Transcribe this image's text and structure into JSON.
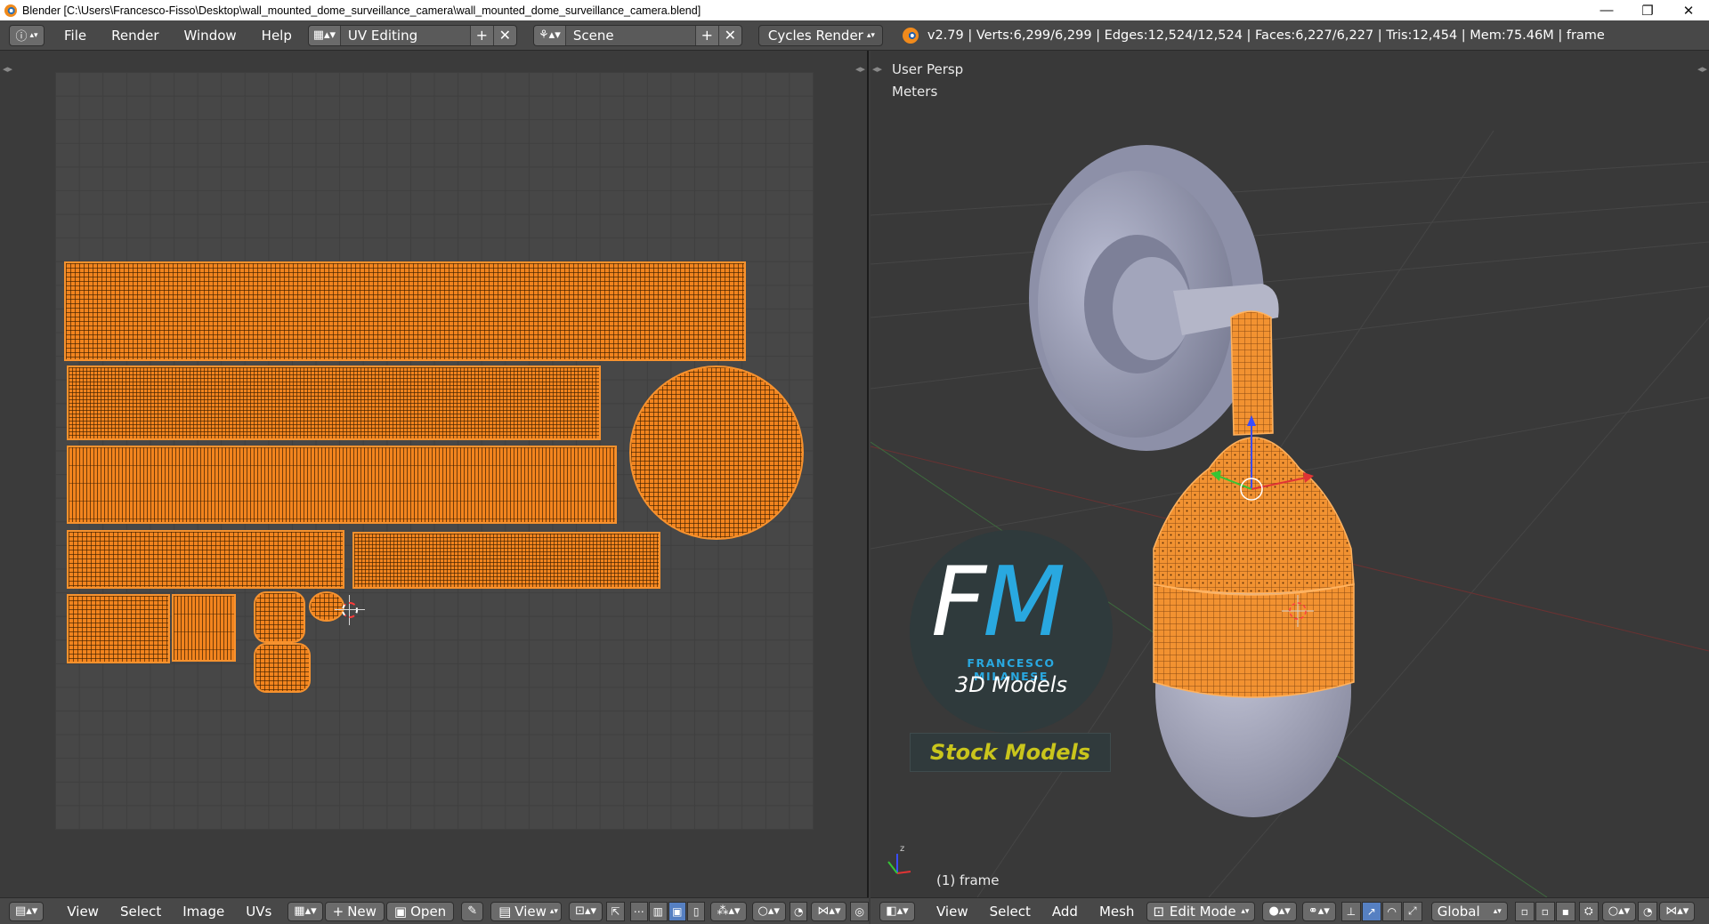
{
  "window": {
    "title": "Blender [C:\\Users\\Francesco-Fisso\\Desktop\\wall_mounted_dome_surveillance_camera\\wall_mounted_dome_surveillance_camera.blend]",
    "minimize": "—",
    "restore": "❐",
    "close": "✕"
  },
  "infobar": {
    "menus": [
      "File",
      "Render",
      "Window",
      "Help"
    ],
    "layout": "UV Editing",
    "scene": "Scene",
    "engine": "Cycles Render",
    "stats": "v2.79 | Verts:6,299/6,299 | Edges:12,524/12,524 | Faces:6,227/6,227 | Tris:12,454 | Mem:75.46M | frame"
  },
  "viewport": {
    "view_name": "User Persp",
    "units": "Meters",
    "object_label": "(1) frame"
  },
  "watermark": {
    "letter_f": "F",
    "letter_m": "M",
    "name": "FRANCESCO MILANESE",
    "subtitle": "3D Models",
    "stock": "Stock Models"
  },
  "uv_header": {
    "menus": [
      "View",
      "Select",
      "Image",
      "UVs"
    ],
    "new_label": "New",
    "open_label": "Open",
    "view_label": "View"
  },
  "view3d_header": {
    "menus": [
      "View",
      "Select",
      "Add",
      "Mesh"
    ],
    "mode": "Edit Mode",
    "orientation": "Global"
  },
  "colors": {
    "accent": "#f2841e",
    "header": "#484848",
    "background": "#393939"
  }
}
